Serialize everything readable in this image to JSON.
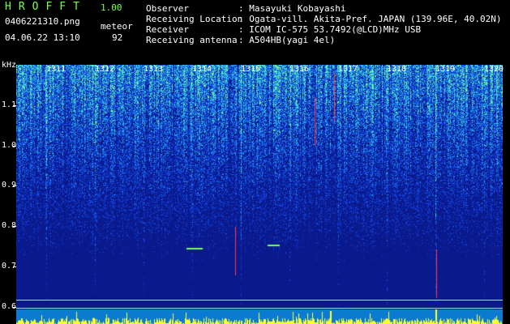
{
  "header": {
    "brand": "HROFFT",
    "version": "1.00",
    "filename": "0406221310.png",
    "timestamp": "04.06.22 13:10",
    "meteor_label": "meteor",
    "meteor_count": "92",
    "observer_label": "Observer",
    "observer_value": ": Masayuki Kobayashi",
    "location_label": "Receiving Location",
    "location_value": ": Ogata-vill. Akita-Pref. JAPAN (139.96E, 40.02N)",
    "receiver_label": "Receiver",
    "receiver_value": ": ICOM IC-575 53.7492(@LCD)MHz USB",
    "antenna_label": "Receiving antenna",
    "antenna_value": ": A504HB(yagi 4el)"
  },
  "axis": {
    "unit": "kHz",
    "y_ticks": [
      "1.1",
      "1.0",
      "0.9",
      "0.8",
      "0.7",
      "0.6"
    ],
    "minutes": [
      "1311",
      "1312",
      "1313",
      "1314",
      "1315",
      "1316",
      "1317",
      "1318",
      "1319",
      "1320"
    ]
  },
  "colors": {
    "background": "#0b1a8a",
    "accent": "#7cff4a"
  }
}
